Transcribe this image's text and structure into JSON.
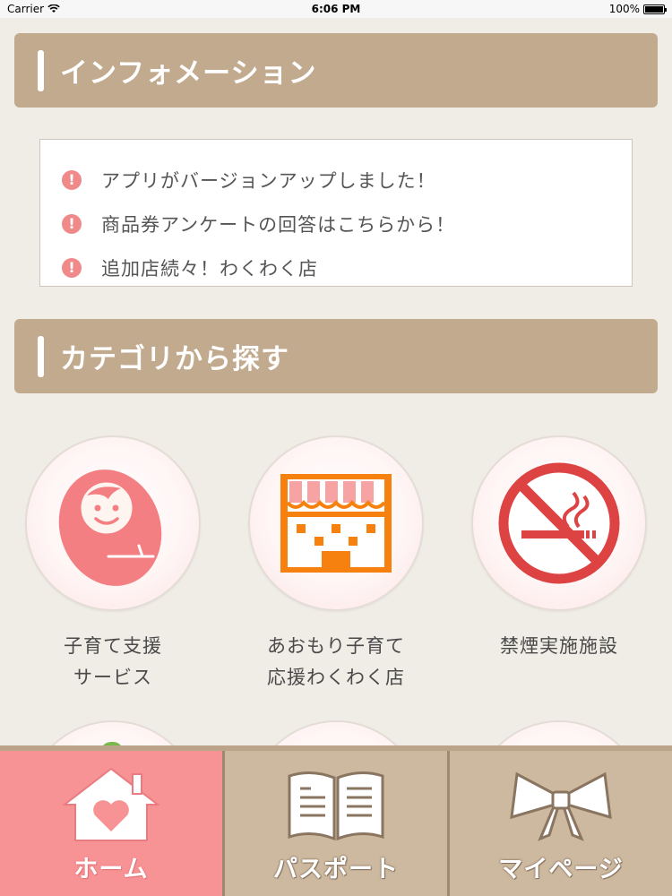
{
  "status_bar": {
    "carrier": "Carrier",
    "time": "6:06 PM",
    "battery": "100%"
  },
  "information": {
    "title": "インフォメーション",
    "items": [
      {
        "text": "アプリがバージョンアップしました！",
        "icon": "alert-icon"
      },
      {
        "text": "商品券アンケートの回答はこちらから！",
        "icon": "alert-icon"
      },
      {
        "text": "追加店続々！わくわく店",
        "icon": "alert-icon"
      }
    ]
  },
  "categories": {
    "title": "カテゴリから探す",
    "items": [
      {
        "line1": "子育て支援",
        "line2": "サービス",
        "icon": "baby-icon"
      },
      {
        "line1": "あおもり子育て",
        "line2": "応援わくわく店",
        "icon": "shop-icon"
      },
      {
        "line1": "禁煙実施施設",
        "line2": "",
        "icon": "no-smoking-icon"
      }
    ]
  },
  "tab_bar": {
    "tabs": [
      {
        "label": "ホーム",
        "icon": "home-icon",
        "active": true
      },
      {
        "label": "パスポート",
        "icon": "book-icon",
        "active": false
      },
      {
        "label": "マイページ",
        "icon": "ribbon-icon",
        "active": false
      }
    ]
  },
  "colors": {
    "header_bg": "#c2aa8e",
    "accent_pink": "#f79295",
    "alert_red": "#f08a8a",
    "shop_orange": "#f7810e"
  }
}
